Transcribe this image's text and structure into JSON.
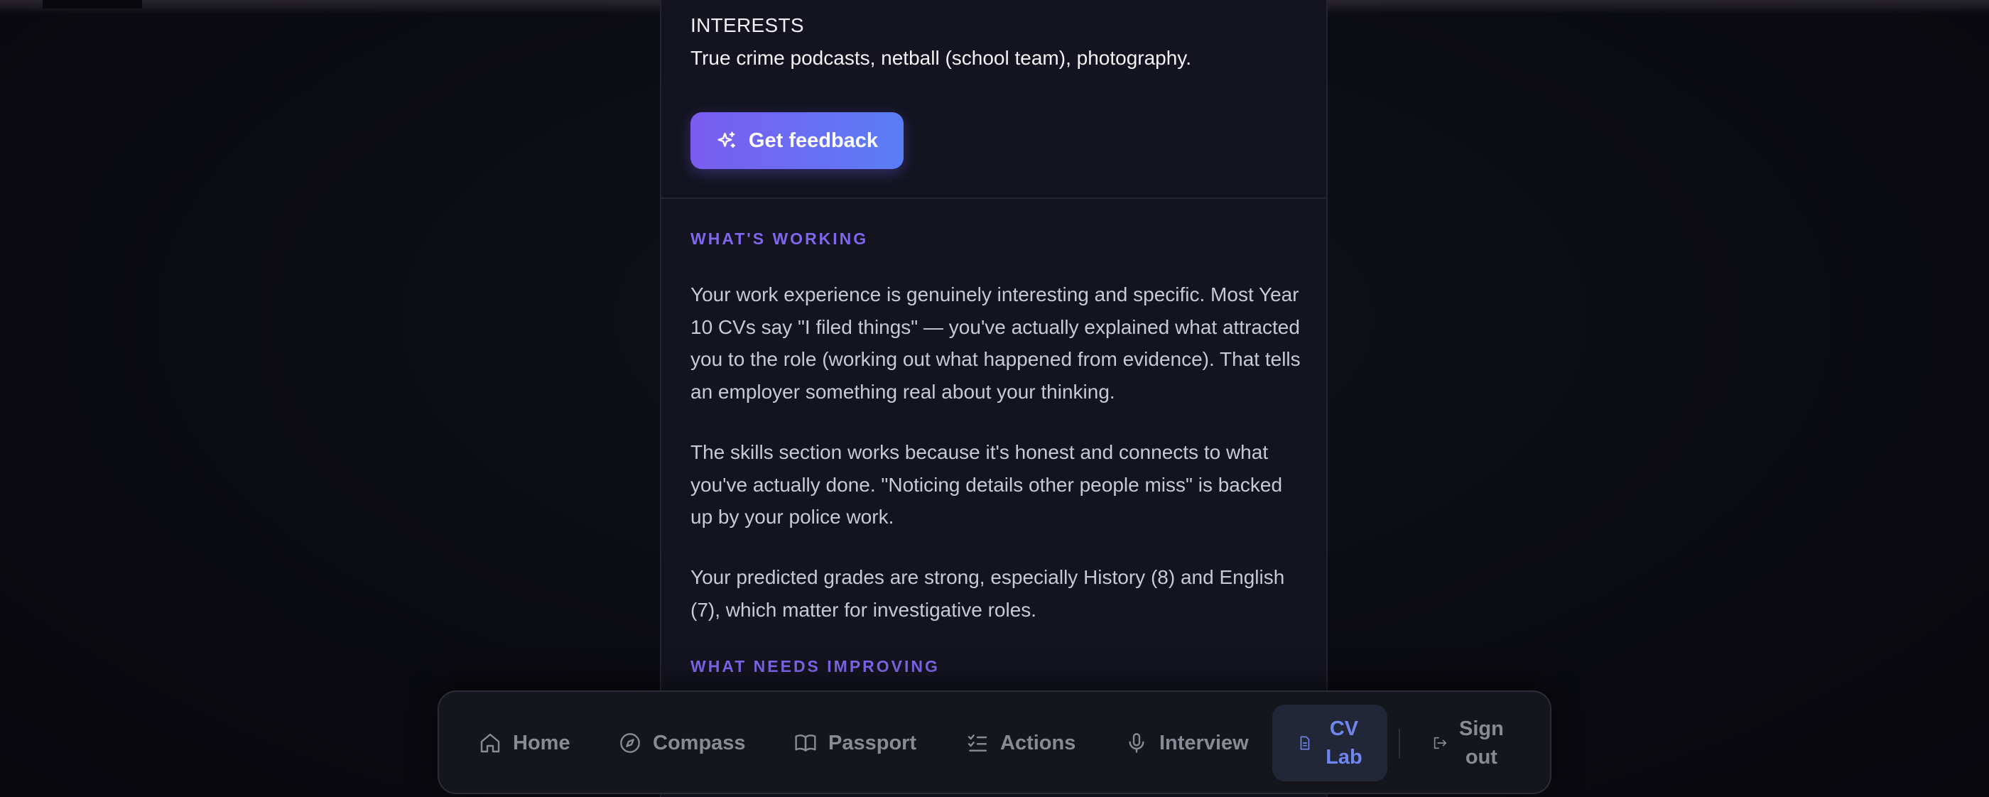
{
  "cv": {
    "interests_label": "INTERESTS",
    "interests_text": "True crime podcasts, netball (school team), photography.",
    "feedback_button": "Get feedback"
  },
  "feedback": {
    "working_title": "WHAT'S WORKING",
    "working_paragraphs": [
      "Your work experience is genuinely interesting and specific. Most Year 10 CVs say \"I filed things\" — you've actually explained what attracted you to the role (working out what happened from evidence). That tells an employer something real about your thinking.",
      "The skills section works because it's honest and connects to what you've actually done. \"Noticing details other people miss\" is backed up by your police work.",
      "Your predicted grades are strong, especially History (8) and English (7), which matter for investigative roles."
    ],
    "improving_title": "WHAT NEEDS IMPROVING"
  },
  "nav": {
    "home": "Home",
    "compass": "Compass",
    "passport": "Passport",
    "actions": "Actions",
    "interview": "Interview",
    "cvlab_line1": "CV",
    "cvlab_line2": "Lab",
    "signout_line1": "Sign",
    "signout_line2": "out",
    "active_tab": "CV Lab"
  },
  "colors": {
    "accent": "#7f66ee",
    "button_gradient_start": "#7a5cf0",
    "button_gradient_end": "#5a7ef5",
    "active_nav": "#6f86f0"
  },
  "icons": {
    "feedback": "sparkles-icon",
    "home": "home-icon",
    "compass": "compass-icon",
    "passport": "book-icon",
    "actions": "checklist-icon",
    "interview": "microphone-icon",
    "cvlab": "document-icon",
    "signout": "logout-icon"
  }
}
